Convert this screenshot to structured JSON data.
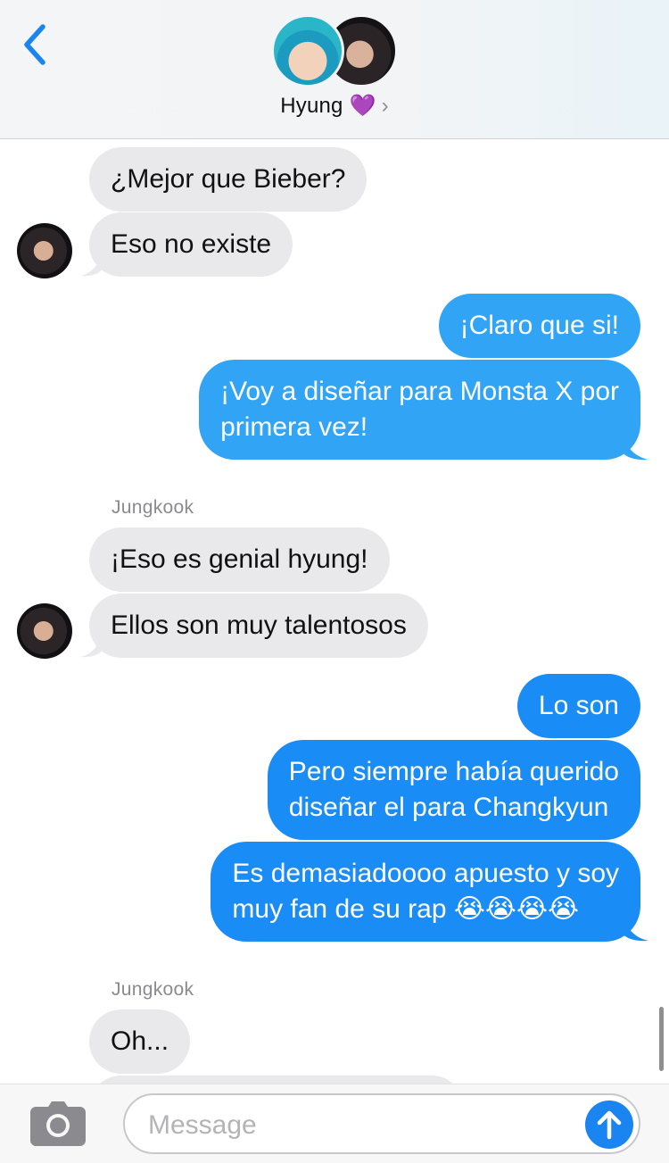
{
  "header": {
    "contact_name": "Hyung 💜",
    "chevron": "›",
    "back_icon": "chevron-left-icon",
    "accent": "#1a84f0"
  },
  "messages": [
    {
      "sender_label": "",
      "text": "¿Mejor que Bieber?",
      "dir": "in"
    },
    {
      "sender_label": "",
      "text": "Eso no existe",
      "dir": "in"
    },
    {
      "text": "¡Claro que si!",
      "dir": "out"
    },
    {
      "text_lines": [
        "¡Voy a diseñar para Monsta X por",
        "primera vez!"
      ],
      "dir": "out"
    },
    {
      "sender_label": "Jungkook",
      "text": "¡Eso es genial hyung!",
      "dir": "in"
    },
    {
      "text": "Ellos son muy talentosos",
      "dir": "in"
    },
    {
      "text": "Lo son",
      "dir": "out"
    },
    {
      "text_lines": [
        "Pero siempre había querido",
        "diseñar el para Changkyun"
      ],
      "dir": "out"
    },
    {
      "text_lines": [
        "Es demasiadoooo apuesto y soy",
        "muy fan de su rap 😭😭😭😭"
      ],
      "dir": "out"
    },
    {
      "sender_label": "Jungkook",
      "text": "Oh...",
      "dir": "in"
    }
  ],
  "sender_names": {
    "second_group": "Jungkook",
    "third_group": "Jungkook"
  },
  "input": {
    "placeholder": "Message",
    "camera_icon": "camera-icon",
    "send_icon": "arrow-up-icon"
  },
  "colors": {
    "incoming_bubble": "#e9e9eb",
    "outgoing_bubble": "#1a8cf5"
  }
}
